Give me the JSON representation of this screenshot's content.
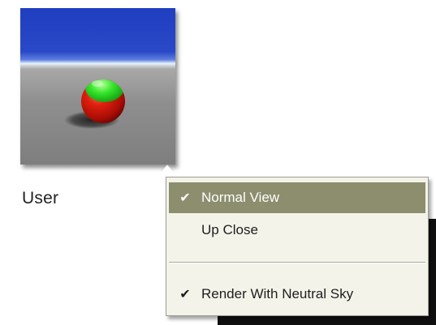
{
  "preview": {
    "name": "User",
    "sky_color": "#2a49c8",
    "ground_color": "#8f8f8f"
  },
  "context_menu": {
    "items": [
      {
        "label": "Normal View",
        "checked": true,
        "selected": true
      },
      {
        "label": "Up Close",
        "checked": false,
        "selected": false
      },
      {
        "label": "Render With Neutral Sky",
        "checked": true,
        "selected": false
      }
    ],
    "check_glyph": "✔",
    "selected_color": "#8c8e6e"
  }
}
